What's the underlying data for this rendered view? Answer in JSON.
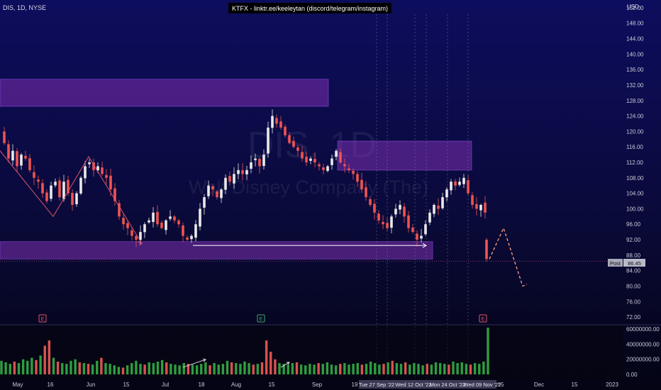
{
  "header": {
    "symbol_info": "DIS, 1D, NYSE",
    "banner": "KTFX - linktr.ee/keeleytan (discord/telegram/instagram)",
    "currency": "USD"
  },
  "watermark": {
    "ticker": "DIS, 1D",
    "company": "Walt Disney Company (The)"
  },
  "price_label": {
    "session": "Post",
    "value": "86.45"
  },
  "earnings_markers": [
    {
      "label": "E",
      "x_date": "2022-05-11",
      "color": "#e0566b"
    },
    {
      "label": "E",
      "x_date": "2022-08-10",
      "color": "#3fa66b"
    },
    {
      "label": "E",
      "x_date": "2022-11-08",
      "color": "#e0566b"
    }
  ],
  "crosshair_dates": [
    "Tue 27 Sep '22",
    "Wed 12 Oct '22",
    "Mon 24 Oct '22",
    "Wed 09 Nov '22"
  ],
  "colors": {
    "up": "#26a69a",
    "down": "#ef5350",
    "zone_fill": "#7b2fb0",
    "projection": "#ff9e80",
    "vol_up": "#2e9e3e",
    "vol_down": "#d9534f"
  },
  "chart_data": {
    "type": "candlestick",
    "x_axis_labels": [
      "May",
      "16",
      "Jun",
      "15",
      "Jul",
      "18",
      "Aug",
      "15",
      "Sep",
      "19",
      "15",
      "Dec",
      "15",
      "2023"
    ],
    "price_axis": {
      "ticks": [
        "152.00",
        "148.00",
        "144.00",
        "140.00",
        "136.00",
        "132.00",
        "128.00",
        "124.00",
        "120.00",
        "116.00",
        "112.00",
        "108.00",
        "104.00",
        "100.00",
        "96.00",
        "92.00",
        "88.00",
        "84.00",
        "80.00",
        "76.00",
        "72.00"
      ],
      "ylim": [
        70,
        156
      ]
    },
    "volume_axis": {
      "ticks": [
        "60000000.00",
        "40000000.00",
        "20000000.00",
        "0.00"
      ],
      "ylim": [
        0,
        62000000
      ]
    },
    "price_path": [
      [
        0,
        120
      ],
      [
        6,
        117
      ],
      [
        12,
        113
      ],
      [
        18,
        115
      ],
      [
        24,
        111
      ],
      [
        30,
        114
      ],
      [
        36,
        113
      ],
      [
        42,
        110
      ],
      [
        48,
        108
      ],
      [
        54,
        107
      ],
      [
        60,
        104
      ],
      [
        66,
        102
      ],
      [
        72,
        106
      ],
      [
        78,
        107
      ],
      [
        84,
        103
      ],
      [
        90,
        107
      ],
      [
        96,
        104
      ],
      [
        102,
        101
      ],
      [
        108,
        104
      ],
      [
        114,
        108
      ],
      [
        120,
        111
      ],
      [
        126,
        112
      ],
      [
        132,
        110
      ],
      [
        138,
        111
      ],
      [
        144,
        109
      ],
      [
        150,
        108
      ],
      [
        156,
        105
      ],
      [
        162,
        102
      ],
      [
        168,
        98
      ],
      [
        174,
        96
      ],
      [
        180,
        95
      ],
      [
        186,
        93
      ],
      [
        192,
        92
      ],
      [
        198,
        94
      ],
      [
        204,
        96
      ],
      [
        210,
        97
      ],
      [
        216,
        99
      ],
      [
        222,
        96
      ],
      [
        228,
        95
      ],
      [
        234,
        97
      ],
      [
        240,
        98
      ],
      [
        246,
        97
      ],
      [
        252,
        96
      ],
      [
        258,
        93
      ],
      [
        264,
        92
      ],
      [
        270,
        93
      ],
      [
        276,
        96
      ],
      [
        282,
        100
      ],
      [
        288,
        103
      ],
      [
        294,
        106
      ],
      [
        300,
        105
      ],
      [
        306,
        103
      ],
      [
        312,
        105
      ],
      [
        318,
        108
      ],
      [
        324,
        107
      ],
      [
        330,
        109
      ],
      [
        336,
        110
      ],
      [
        342,
        109
      ],
      [
        348,
        110
      ],
      [
        354,
        112
      ],
      [
        360,
        113
      ],
      [
        366,
        111
      ],
      [
        372,
        114
      ],
      [
        378,
        121
      ],
      [
        384,
        124
      ],
      [
        390,
        122
      ],
      [
        396,
        121
      ],
      [
        402,
        119
      ],
      [
        408,
        117
      ],
      [
        414,
        116
      ],
      [
        420,
        115
      ],
      [
        426,
        113
      ],
      [
        432,
        112
      ],
      [
        438,
        113
      ],
      [
        444,
        112
      ],
      [
        450,
        111
      ],
      [
        456,
        110
      ],
      [
        462,
        111
      ],
      [
        468,
        113
      ],
      [
        474,
        115
      ],
      [
        480,
        112
      ],
      [
        486,
        111
      ],
      [
        492,
        110
      ],
      [
        498,
        109
      ],
      [
        504,
        107
      ],
      [
        510,
        105
      ],
      [
        516,
        103
      ],
      [
        522,
        101
      ],
      [
        528,
        99
      ],
      [
        534,
        97
      ],
      [
        540,
        96
      ],
      [
        546,
        95
      ],
      [
        552,
        98
      ],
      [
        558,
        100
      ],
      [
        564,
        101
      ],
      [
        570,
        98
      ],
      [
        576,
        95
      ],
      [
        582,
        94
      ],
      [
        588,
        92
      ],
      [
        594,
        93
      ],
      [
        600,
        96
      ],
      [
        606,
        99
      ],
      [
        612,
        101
      ],
      [
        618,
        100
      ],
      [
        624,
        103
      ],
      [
        630,
        105
      ],
      [
        636,
        107
      ],
      [
        642,
        106
      ],
      [
        648,
        107
      ],
      [
        654,
        108
      ],
      [
        660,
        104
      ],
      [
        666,
        101
      ],
      [
        672,
        100
      ],
      [
        678,
        101
      ],
      [
        684,
        99
      ]
    ],
    "gap_candle": {
      "x": 686,
      "open": 92,
      "close": 87,
      "high": 92.5,
      "low": 86.3
    },
    "volume": [
      18,
      16,
      14,
      17,
      15,
      20,
      18,
      22,
      19,
      25,
      38,
      45,
      22,
      17,
      15,
      14,
      18,
      20,
      16,
      15,
      14,
      13,
      18,
      22,
      15,
      14,
      12,
      10,
      9,
      12,
      15,
      18,
      14,
      13,
      16,
      15,
      17,
      19,
      16,
      14,
      13,
      12,
      15,
      14,
      13,
      12,
      14,
      16,
      12,
      15,
      13,
      14,
      18,
      16,
      15,
      14,
      17,
      15,
      13,
      14,
      16,
      45,
      30,
      20,
      15,
      14,
      13,
      15,
      16,
      13,
      12,
      14,
      13,
      15,
      14,
      16,
      13,
      12,
      14,
      15,
      13,
      14,
      15,
      13,
      14,
      17,
      15,
      13,
      14,
      16,
      18,
      15,
      14,
      16,
      13,
      15,
      14,
      12,
      14,
      13,
      16,
      15,
      14,
      13,
      17,
      15,
      16,
      14,
      13,
      15,
      14,
      17,
      62
    ],
    "volume_down_idx": [
      10,
      11,
      20,
      60,
      61,
      62,
      90,
      103
    ],
    "zones": [
      {
        "y_top": 133.5,
        "y_bottom": 126.5,
        "x_start_frac": 0.0,
        "x_end_frac": 0.497
      },
      {
        "y_top": 117.5,
        "y_bottom": 110.0,
        "x_start_frac": 0.51,
        "x_end_frac": 0.714
      },
      {
        "y_top": 91.5,
        "y_bottom": 87.0,
        "x_start_frac": 0.0,
        "x_end_frac": 0.655
      }
    ],
    "pattern_lines": [
      {
        "points": [
          [
            0,
            115
          ],
          [
            75,
            98
          ],
          [
            125,
            113.5
          ],
          [
            200,
            91
          ]
        ],
        "color": "#e0566b"
      },
      {
        "points": [
          [
            272,
            90.5
          ],
          [
            600,
            90.5
          ]
        ],
        "color": "#ffffff"
      }
    ],
    "projection": {
      "points": [
        [
          690,
          87
        ],
        [
          710,
          95
        ],
        [
          737,
          80
        ],
        [
          743,
          80.5
        ]
      ]
    },
    "last_price_line": 86.45
  }
}
